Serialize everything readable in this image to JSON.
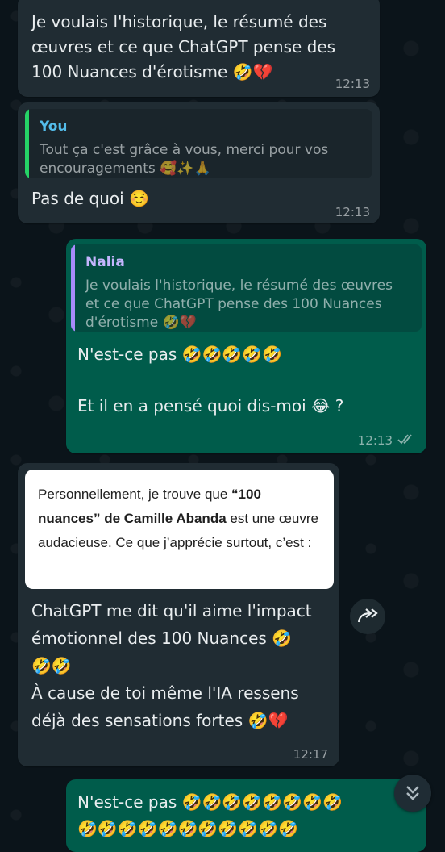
{
  "messages": {
    "m1": {
      "text": "Je voulais l'historique, le résumé des\nœuvres et ce que ChatGPT pense des\n100 Nuances d'érotisme 🤣💔",
      "time": "12:13"
    },
    "m2": {
      "quote_author": "You",
      "quote_text": "Tout ça c'est grâce à vous, merci pour vos encouragements 🥰✨🙏",
      "text": "Pas de quoi ☺️",
      "time": "12:13"
    },
    "m3": {
      "quote_author": "Nalia",
      "quote_text": "Je voulais l'historique, le résumé des œuvres et ce que ChatGPT pense des 100 Nuances d'érotisme 🤣💔",
      "text_line1": "N'est-ce pas 🤣🤣🤣🤣🤣",
      "text_line2": "Et il en a pensé quoi dis-moi 😂 ?",
      "time": "12:13",
      "status": "✓✓"
    },
    "m4": {
      "card_part1": "Personnellement, je trouve que ",
      "card_bold": "“100 nuances” de Camille Abanda",
      "card_part2": " est une œuvre audacieuse. Ce que j’apprécie surtout, c’est :",
      "text": "ChatGPT me dit qu'il aime l'impact\némotionnel des 100 Nuances 🤣\n🤣🤣\nÀ cause de toi même l'IA ressens\ndéjà des sensations fortes 🤣💔",
      "time": "12:17"
    },
    "m5": {
      "text_line1": "N'est-ce pas 🤣🤣🤣🤣🤣🤣🤣🤣",
      "text_line2": "🤣🤣🤣🤣🤣🤣🤣🤣🤣🤣🤣"
    }
  },
  "colors": {
    "background": "#0b141a",
    "incoming_bubble": "#202c33",
    "outgoing_bubble": "#005c4b",
    "you_author": "#53bdeb",
    "nalia_author": "#a5b4fc",
    "quote_bar_you": "#25d366",
    "quote_bar_nalia": "#a78bfa"
  },
  "icons": {
    "forward": "forward-arrow-icon",
    "scroll_down": "double-chevron-down-icon",
    "read_receipt": "double-check-icon"
  }
}
